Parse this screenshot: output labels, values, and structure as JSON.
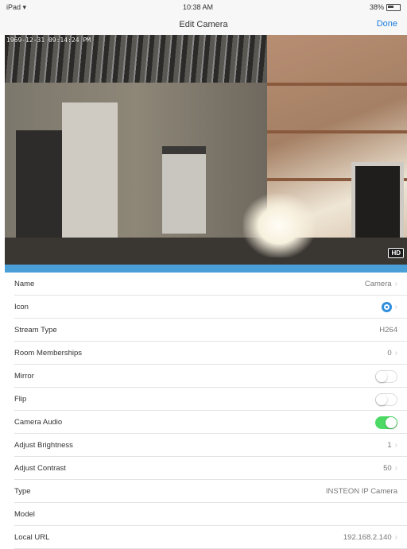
{
  "status_bar": {
    "carrier": "iPad",
    "time": "10:38 AM",
    "battery": "38%"
  },
  "nav": {
    "title": "Edit Camera",
    "done_label": "Done"
  },
  "camera": {
    "timestamp": "1969-12-31 09:14:24 PM",
    "badge": "HD"
  },
  "settings": [
    {
      "label": "Name",
      "value": "Camera",
      "chevron": true
    },
    {
      "label": "Icon",
      "value": "camera-icon",
      "chevron": true
    },
    {
      "label": "Stream Type",
      "value": "H264",
      "chevron": false
    },
    {
      "label": "Room Memberships",
      "value": "0",
      "chevron": true
    },
    {
      "label": "Mirror",
      "toggle": false
    },
    {
      "label": "Flip",
      "toggle": false
    },
    {
      "label": "Camera Audio",
      "toggle": true
    },
    {
      "label": "Adjust Brightness",
      "value": "1",
      "chevron": true
    },
    {
      "label": "Adjust Contrast",
      "value": "50",
      "chevron": true
    },
    {
      "label": "Type",
      "value": "INSTEON IP Camera",
      "chevron": false
    },
    {
      "label": "Model",
      "value": "",
      "chevron": false
    },
    {
      "label": "Local URL",
      "value": "192.168.2.140",
      "chevron": true
    }
  ],
  "colors": {
    "accent": "#1a7bdc",
    "toggle_on": "#4cd964",
    "strip": "#4a9fd8"
  }
}
